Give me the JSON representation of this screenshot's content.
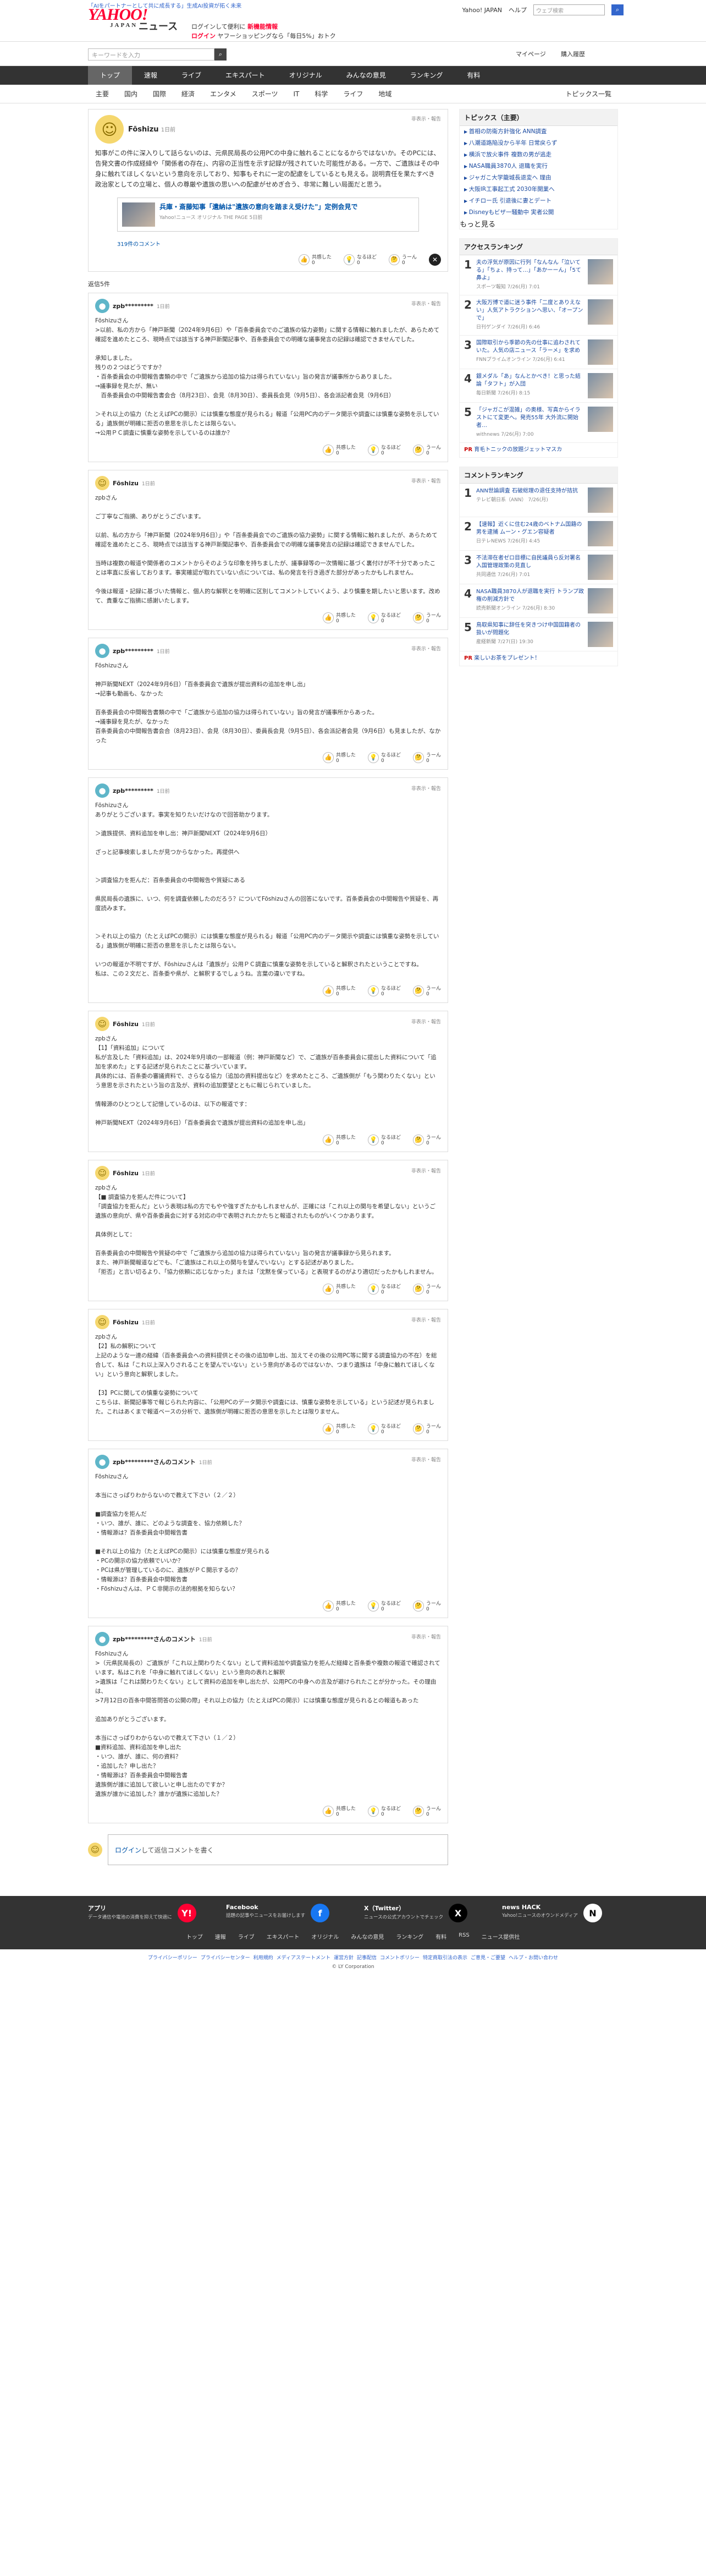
{
  "header": {
    "pr_top": "「AIをパートナーとして共に成長する」生成AI投資が拓く未来",
    "logo": "YAHOO!",
    "logo_sub": "JAPAN",
    "news_label": "ニュース",
    "promo_line1": "ログインして便利に",
    "promo_new": "新機能情報",
    "promo_line2": "ログイン",
    "promo_line3": "ヤフーショッピングなら「毎日5%」おトク",
    "yahoo_japan": "Yahoo! JAPAN",
    "help": "ヘルプ",
    "search_placeholder": "ウェブ検索",
    "search_icon": "search-icon"
  },
  "subbar": {
    "keyword_placeholder": "キーワードを入力",
    "mypage": "マイページ",
    "buy": "購入履歴"
  },
  "gnav": [
    "トップ",
    "速報",
    "ライブ",
    "エキスパート",
    "オリジナル",
    "みんなの意見",
    "ランキング",
    "有料"
  ],
  "gnav2": [
    "主要",
    "国内",
    "国際",
    "経済",
    "エンタメ",
    "スポーツ",
    "IT",
    "科学",
    "ライフ",
    "地域"
  ],
  "gnav2_right": "トピックス一覧",
  "main_comment": {
    "user": "Fōshizu",
    "time": "1日前",
    "report": "非表示・報告",
    "text": "知事がこの件に深入りして話らないのは、元県民局長の公用PCの中身に触れることになるからではないか。そのPCには、告発文書の作成経緯や「関係者の存在」、内容の正当性を示す記録が残されていた可能性がある。一方で、ご遺族はその中身に触れてほしくないという意向を示しており、知事もそれに一定の配慮をしているとも見える。説明責任を果たすべき政治家としての立場と、個人の尊厳や遺族の思いへの配慮がせめぎ合う、非常に難しい局面だと思う。",
    "link_title": "兵庫・斎藤知事「遺納は\"遺族の意向を踏まえ受けた\"」定例会見で",
    "link_source": "Yahoo!ニュース オリジナル THE PAGE 5日前",
    "comment_count": "319件のコメント",
    "reactions": [
      {
        "label": "共感した",
        "count": "0"
      },
      {
        "label": "なるほど",
        "count": "0"
      },
      {
        "label": "うーん",
        "count": "0"
      }
    ]
  },
  "section_label": "返信5件",
  "replies": [
    {
      "user": "zpb*********",
      "time": "1日前",
      "report": "非表示・報告",
      "text": "Fōshizuさん\n>以前、私の方から「神戸新聞（2024年9月6日）や「百条委員会でのご遺族の協力姿勢」に関する情報に触れましたが、あらためて確認を進めたところ、現時点では該当する神戸新聞記事や、百条委員会での明確な議事発言の記録は確認できませんでした。\n\n承知しました。\n残りの２つはどうですか？\n・百条委員会の中間報告書類の中で「ご遺族から追加の協力は得られていない」旨の発言が議事所からありました。\n→議事録を見たが、無い\n　百条委員会の中間報告書会合（8月23日）、会見（8月30日）、委員長会見（9月5日）、各会派記者会見（9月6日）\n\n＞それ以上の協力（たとえばPCの開示）には慎重な態度が見られる」報道「公用PC内のデータ開示や調査には慎重な姿勢を示している」遺族側が明確に拒否の意思を示したとは限らない。\n→公用ＰＣ調査に慎重な姿勢を示しているのは誰か？",
      "reactions": [
        {
          "label": "共感した",
          "count": "0"
        },
        {
          "label": "なるほど",
          "count": "0"
        },
        {
          "label": "うーん",
          "count": "0"
        }
      ]
    },
    {
      "user": "Fōshizu",
      "time": "1日前",
      "report": "非表示・報告",
      "text": "zpbさん\n\nご丁寧なご指摘、ありがとうございます。\n\n以前、私の方から「神戸新聞（2024年9月6日）」や「百条委員会でのご遺族の協力姿勢」に関する情報に触れましたが、あらためて確認を進めたところ、現時点では該当する神戸新聞記事や、百条委員会での明確な議事発言の記録は確認できませんでした。\n\n当時は複数の報道や関係者のコメントからそのような印象を持ちましたが、議事録等の一次情報に基づく裏付けが不十分であったことは率直に反省しております。事実確認が取れていない点については、私の発言を行き過ぎた部分があったかもしれません。\n\n今後は報道・記録に基づいた情報と、個人的な解釈とを明確に区別してコメントしていくよう、より慎重を期したいと思います。改めて、貴重なご指摘に感謝いたします。",
      "reactions": [
        {
          "label": "共感した",
          "count": "0"
        },
        {
          "label": "なるほど",
          "count": "0"
        },
        {
          "label": "うーん",
          "count": "0"
        }
      ]
    },
    {
      "user": "zpb*********",
      "time": "1日前",
      "report": "非表示・報告",
      "text": "Fōshizuさん\n\n神戸新聞NEXT（2024年9月6日）「百条委員会で遺族が提出資料の追加を申し出」\n→記事も動画も、なかった\n\n百条委員会の中間報告書類の中で「ご遺族から追加の協力は得られていない」旨の発言が議事所からあった。\n→議事録を見たが、なかった\n百条委員会の中間報告書会合（8月23日）、会見（8月30日）、委員長会見（9月5日）、各会派記者会見（9月6日）も見ましたが、なかった",
      "reactions": [
        {
          "label": "共感した",
          "count": "0"
        },
        {
          "label": "なるほど",
          "count": "0"
        },
        {
          "label": "うーん",
          "count": "0"
        }
      ]
    },
    {
      "user": "zpb*********",
      "time": "1日前",
      "report": "非表示・報告",
      "text": "Fōshizuさん\nありがとうございます。事実を知りたいだけなので回答助かります。\n\n＞遺族提供、資料追加を申し出：神戸新聞NEXT（2024年9月6日）\n\nざっと記事検索しましたが見つからなかった。再提供へ\n\n\n＞調査協力を拒んだ：百条委員会の中間報告や質疑にある\n\n県民局長の遺族に、いつ、何を調査依頼したのだろう？についてFōshizuさんの回答にないです。百条委員会の中間報告や質疑を、再度読みます。\n\n\n＞それ以上の協力（たとえばPCの開示）には慎重な態度が見られる」報道「公用PC内のデータ開示や調査には慎重な姿勢を示している」遺族側が明確に拒否の意思を示したとは限らない。\n\nいつの報道か不明ですが、Fōshizuさんは「遺族が」公用ＰＣ調査に慎重な姿勢を示していると解釈されたということですね。\n私は、この２文だと、百条委や県が、と解釈するでしょうね。言葉の違いですね。",
      "reactions": [
        {
          "label": "共感した",
          "count": "0"
        },
        {
          "label": "なるほど",
          "count": "0"
        },
        {
          "label": "うーん",
          "count": "0"
        }
      ]
    },
    {
      "user": "Fōshizu",
      "time": "1日前",
      "report": "非表示・報告",
      "text": "zpbさん\n【1】「資料追加」について\n私が言及した「資料追加」は、2024年9月頃の一部報道（例：神戸新聞など）で、ご遺族が百条委員会に提出した資料について「追加を求めた」とする記述が見られたことに基づいています。\n具体的には、百条委の審議資料で、さらなる協力（追加の資料提出など）を求めたところ、ご遺族側が「もう関わりたくない」という意思を示されたという旨の言及が、資料の追加要望とともに報じられていました。\n\n情報源のひとつとして記憶しているのは、以下の報道です：\n\n神戸新聞NEXT（2024年9月6日）「百条委員会で遺族が提出資料の追加を申し出」",
      "reactions": [
        {
          "label": "共感した",
          "count": "0"
        },
        {
          "label": "なるほど",
          "count": "0"
        },
        {
          "label": "うーん",
          "count": "0"
        }
      ]
    },
    {
      "user": "Fōshizu",
      "time": "1日前",
      "report": "非表示・報告",
      "text": "zpbさん\n【■ 調査協力を拒んだ件について】\n「調査協力を拒んだ」という表現は私の方でもやや強すぎたかもしれませんが、正確には「これ以上の関与を希望しない」というご遺族の意向が、県や百条委員会に対する対応の中で表明されたかたちと報道されたものがいくつかあります。\n\n具体例として：\n\n百条委員会の中間報告や質疑の中で「ご遺族から追加の協力は得られていない」旨の発言が議事録から見られます。\nまた、神戸新聞報道などでも、「ご遺族はこれ以上の関与を望んでいない」とする記述がありました。\n「拒否」と言い切るより、「協力依頼に応じなかった」または「沈黙を保っている」と表現するのがより適切だったかもしれません。",
      "reactions": [
        {
          "label": "共感した",
          "count": "0"
        },
        {
          "label": "なるほど",
          "count": "0"
        },
        {
          "label": "うーん",
          "count": "0"
        }
      ]
    },
    {
      "user": "Fōshizu",
      "time": "1日前",
      "report": "非表示・報告",
      "text": "zpbさん\n【2】私の解釈について\n上記のような一連の経緯（百条委員会への資料提供とその後の追加申し出、加えてその後の公用PC等に関する調査協力の不在）を総合して、私は「これ以上深入りされることを望んでいない」という意向があるのではないか、つまり遺族は「中身に触れてほしくない」という意向と解釈しました。\n\n【3】PCに関しての慎重な姿勢について\nこちらは、新聞記事等で報じられた内容に、「公用PCのデータ開示や調査には、慎重な姿勢を示している」という記述が見られました。これはあくまで報道ベースの分析で、遺族側が明確に拒否の意思を示したとは限りません。",
      "reactions": [
        {
          "label": "共感した",
          "count": "0"
        },
        {
          "label": "なるほど",
          "count": "0"
        },
        {
          "label": "うーん",
          "count": "0"
        }
      ]
    },
    {
      "user": "zpb*********さんのコメント",
      "time": "1日前",
      "report": "非表示・報告",
      "text": "Fōshizuさん\n\n本当にさっぱりわからないので教えて下さい（２／２）\n\n■調査協力を拒んだ\n・いつ、誰が、誰に、どのような調査を、協力依頼した？\n・情報源は？百条委員会中間報告書\n\n■それ以上の協力（たとえばPCの開示）には慎重な態度が見られる\n・PCの開示の協力依頼でいいか？\n・PCは県が管理しているのに、遺族がＰＣ開示するの？\n・情報源は？百条委員会中間報告書\n・Fōshizuさんは、ＰＣ非開示の法的根拠を知らない？",
      "reactions": [
        {
          "label": "共感した",
          "count": "0"
        },
        {
          "label": "なるほど",
          "count": "0"
        },
        {
          "label": "うーん",
          "count": "0"
        }
      ]
    },
    {
      "user": "zpb*********さんのコメント",
      "time": "1日前",
      "report": "非表示・報告",
      "text": "Fōshizuさん\n>（元県民局長の）ご遺族が「これ以上関わりたくない」として資料追加や調査協力を拒んだ経緯と百条委や複数の報道で確認されています。私はこれを「中身に触れてほしくない」という意向の表れと解釈\n>遺族は「これは関わりたくない」として資料の追加を申し出たが、公用PCの中身への言及が避けられたことが分かった。その理由は、\n>7月12日の百条中間答問答の公開の際」それ以上の協力（たとえばPCの開示）には慎重な態度が見られるとの報道もあった\n\n追加ありがとうございます。\n\n本当にさっぱりわからないので教えて下さい（１／２）\n■資料追加、資料追加を申し出た\n・いつ、誰が、誰に、何の資料？\n・追加した？申し出た？\n・情報源は？百条委員会中間報告書\n遺族側が誰に追加して欲しいと申し出たのですか？\n遺族が誰かに追加した？誰かが遺族に追加した？",
      "reactions": [
        {
          "label": "共感した",
          "count": "0"
        },
        {
          "label": "なるほど",
          "count": "0"
        },
        {
          "label": "うーん",
          "count": "0"
        }
      ]
    }
  ],
  "login_prompt_link": "ログイン",
  "login_prompt_text": "して返信コメントを書く",
  "sidebar": {
    "topics_title": "トピックス（主要）",
    "topics": [
      "首相の防衛方針強化 ANN調査",
      "八潮道路陥没から半年 日常戻らず",
      "横浜で放火事件 複数の男が逃走",
      "NASA職員3870人 退職を実行",
      "ジャガこ大学籠城長退変へ 理由",
      "大阪IR工事起工式 2030年開業へ",
      "イチロー氏 引退後に妻とデート",
      "Disneyもビザ一騒動中 実者公開"
    ],
    "topics_more": "もっと見る",
    "access_title": "アクセスランキング",
    "access": [
      {
        "no": "1",
        "text": "夫の浮気が原因に行列「なんなん「泣いてる」「ちょ、持って…」「あかーーん」「5て鼻よ」",
        "meta": "スポーツ報知 7/26(月) 7:01"
      },
      {
        "no": "2",
        "text": "大阪万博で道に迷う事件「二度とありえない」人気アトラクションへ思い、「オープンで」",
        "meta": "日刊ゲンダイ 7/26(月) 6:46"
      },
      {
        "no": "3",
        "text": "国際取引から季節の先の仕事に追わされていた。人気の店ニュース「ラーメ」を求め",
        "meta": "FNNプライムオンライン 7/26(月) 6:41"
      },
      {
        "no": "4",
        "text": "銀メダル「あ」なんとかべき！と思った結論「タフト」が入団",
        "meta": "毎日新聞 7/26(月) 8:15"
      },
      {
        "no": "5",
        "text": "「ジャガこが混雑」の奥様、写真からイラストにて変更へ。発売55年 大外流に開始者…",
        "meta": "withnews 7/26(月) 7:00"
      }
    ],
    "pr_label": "PR",
    "pr_text": "育毛トニックの放題ジェットマスカ",
    "comment_title": "コメントランキング",
    "comment_rank": [
      {
        "no": "1",
        "text": "ANN世論調査 石破総理の退任支持が拮抗",
        "meta": "テレビ朝日系（ANN） 7/26(月)"
      },
      {
        "no": "2",
        "text": "【速報】近くに住む24歳のベトナム国籍の男を逮捕 ムーン・グエン容疑者",
        "meta": "日テレNEWS 7/26(月) 4:45"
      },
      {
        "no": "3",
        "text": "不法滞在者ゼロ目標に自民議員ら反対署名 入国管理政策の見直し",
        "meta": "共同通信 7/26(月) 7:01"
      },
      {
        "no": "4",
        "text": "NASA職員3870人が退職を実行 トランプ政権の削減方針で",
        "meta": "読売新聞オンライン 7/26(月) 8:30"
      },
      {
        "no": "5",
        "text": "鳥取県知事に辞任を突きつけ中国国籍者の扱いが問題化",
        "meta": "産経新聞 7/27(日) 19:30"
      }
    ],
    "pr2_text": "楽しいお茶をプレゼント！"
  },
  "footer": {
    "apps": [
      {
        "title": "アプリ",
        "desc": "データ通信や電池の消費を抑えて快適に",
        "icon": "Y!",
        "color": "#ff0033"
      },
      {
        "title": "Facebook",
        "desc": "話題の記事やニュースをお届けします",
        "icon": "f",
        "color": "#1877f2"
      },
      {
        "title": "X（Twitter）",
        "desc": "ニュースの公式アカウントでチェック",
        "icon": "X",
        "color": "#000000"
      },
      {
        "title": "news HACK",
        "desc": "Yahoo!ニュースのオウンドメディア",
        "icon": "N",
        "color": "#ffffff"
      }
    ],
    "nav": [
      "トップ",
      "速報",
      "ライブ",
      "エキスパート",
      "オリジナル",
      "みんなの意見",
      "ランキング",
      "有料",
      "RSS",
      "ニュース提供社"
    ],
    "legal": [
      "プライバシーポリシー",
      "プライバシーセンター",
      "利用規約",
      "メディアステートメント",
      "運営方針",
      "記事配信",
      "コメントポリシー",
      "特定商取引法の表示",
      "ご意見・ご要望",
      "ヘルプ・お問い合わせ"
    ],
    "copyright": "© LY Corporation"
  }
}
